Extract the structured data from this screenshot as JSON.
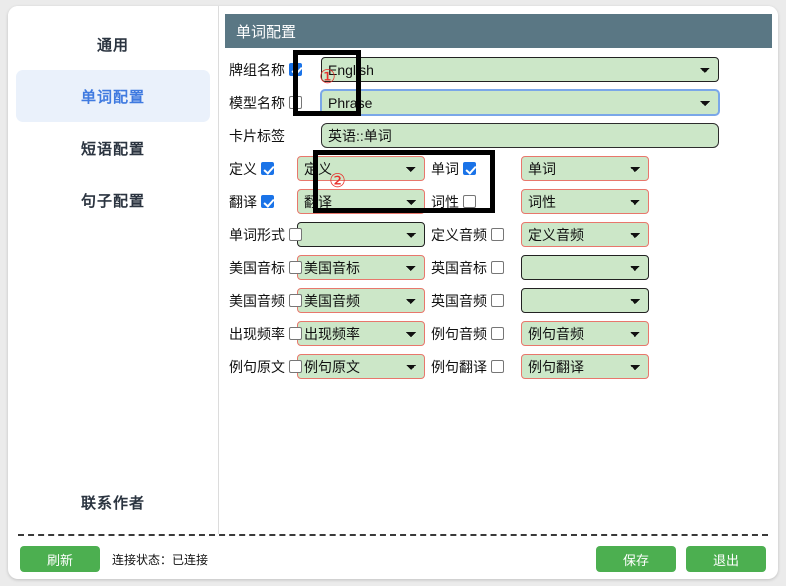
{
  "sidebar": {
    "items": [
      {
        "label": "通用",
        "active": false
      },
      {
        "label": "单词配置",
        "active": true
      },
      {
        "label": "短语配置",
        "active": false
      },
      {
        "label": "句子配置",
        "active": false
      }
    ],
    "footer_label": "联系作者"
  },
  "panel": {
    "title": "单词配置"
  },
  "form": {
    "deck_name": {
      "label": "牌组名称",
      "checked": true,
      "value": "English"
    },
    "model_name": {
      "label": "模型名称",
      "checked": false,
      "value": "Phrase"
    },
    "card_tag": {
      "label": "卡片标签",
      "value": "英语::单词"
    },
    "pairs": [
      {
        "left": {
          "label": "定义",
          "checked": true,
          "value": "定义",
          "border": "red",
          "empty": false
        },
        "right": {
          "label": "单词",
          "checked": true,
          "value": "单词",
          "border": "red",
          "empty": false
        }
      },
      {
        "left": {
          "label": "翻译",
          "checked": true,
          "value": "翻译",
          "border": "red",
          "empty": false
        },
        "right": {
          "label": "词性",
          "checked": false,
          "value": "词性",
          "border": "red",
          "empty": false
        }
      },
      {
        "left": {
          "label": "单词形式",
          "checked": false,
          "value": "",
          "border": "dark",
          "empty": true
        },
        "right": {
          "label": "定义音频",
          "checked": false,
          "value": "定义音频",
          "border": "red",
          "empty": false
        }
      },
      {
        "left": {
          "label": "美国音标",
          "checked": false,
          "value": "美国音标",
          "border": "red",
          "empty": false
        },
        "right": {
          "label": "英国音标",
          "checked": false,
          "value": "",
          "border": "dark",
          "empty": true
        }
      },
      {
        "left": {
          "label": "美国音频",
          "checked": false,
          "value": "美国音频",
          "border": "red",
          "empty": false
        },
        "right": {
          "label": "英国音频",
          "checked": false,
          "value": "",
          "border": "dark",
          "empty": true
        }
      },
      {
        "left": {
          "label": "出现频率",
          "checked": false,
          "value": "出现频率",
          "border": "red",
          "empty": false
        },
        "right": {
          "label": "例句音频",
          "checked": false,
          "value": "例句音频",
          "border": "red",
          "empty": false
        }
      },
      {
        "left": {
          "label": "例句原文",
          "checked": false,
          "value": "例句原文",
          "border": "red",
          "empty": false
        },
        "right": {
          "label": "例句翻译",
          "checked": false,
          "value": "例句翻译",
          "border": "red",
          "empty": false
        }
      }
    ]
  },
  "annotations": [
    {
      "number": "①"
    },
    {
      "number": "②"
    }
  ],
  "bottom": {
    "refresh_label": "刷新",
    "status_text": "连接状态：已连接",
    "save_label": "保存",
    "exit_label": "退出"
  },
  "colors": {
    "accent_green": "#4caf50",
    "field_green": "#cce7c8",
    "title_bar": "#5a7784",
    "active_nav_text": "#3f7ae0",
    "annotation_red": "#e8302c",
    "select_red_border": "#e8776c"
  }
}
